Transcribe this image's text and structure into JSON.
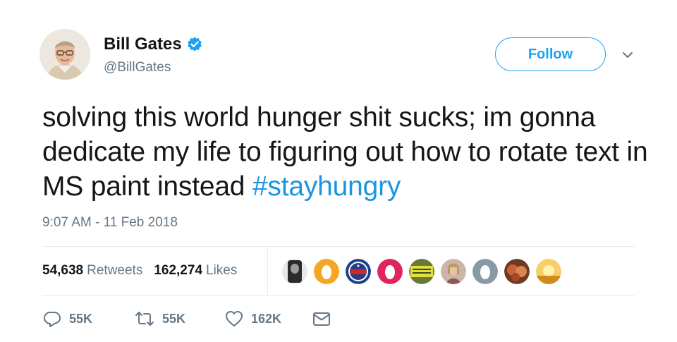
{
  "author": {
    "display_name": "Bill Gates",
    "handle": "@BillGates",
    "verified": true,
    "avatar_icon": "profile-photo"
  },
  "follow_button": {
    "label": "Follow"
  },
  "menu_icon": "chevron-down-icon",
  "tweet": {
    "text": "solving this world hunger shit sucks; im gonna dedicate my life to figuring out how to rotate text in MS paint instead ",
    "hashtag": "#stayhungry",
    "timestamp": "9:07 AM - 11 Feb 2018"
  },
  "stats": {
    "retweets": {
      "count": "54,638",
      "label": "Retweets"
    },
    "likes": {
      "count": "162,274",
      "label": "Likes"
    }
  },
  "likers": [
    {
      "name": "liker-1",
      "color": "#2b2b2b"
    },
    {
      "name": "liker-2",
      "color": "#f5a623"
    },
    {
      "name": "liker-3",
      "color": "#1e3f8a"
    },
    {
      "name": "liker-4",
      "color": "#e0245e"
    },
    {
      "name": "liker-5",
      "color": "#c7c93a"
    },
    {
      "name": "liker-6",
      "color": "#b08a8a"
    },
    {
      "name": "liker-7",
      "color": "#8899a6"
    },
    {
      "name": "liker-8",
      "color": "#b5562a"
    },
    {
      "name": "liker-9",
      "color": "#f7b733"
    }
  ],
  "actions": {
    "reply": {
      "count": "55K",
      "icon": "reply-icon"
    },
    "retweet": {
      "count": "55K",
      "icon": "retweet-icon"
    },
    "like": {
      "count": "162K",
      "icon": "heart-icon"
    },
    "message": {
      "icon": "envelope-icon"
    }
  },
  "colors": {
    "accent": "#1da1f2",
    "hashtag": "#1b95e0",
    "secondary_text": "#657786"
  }
}
